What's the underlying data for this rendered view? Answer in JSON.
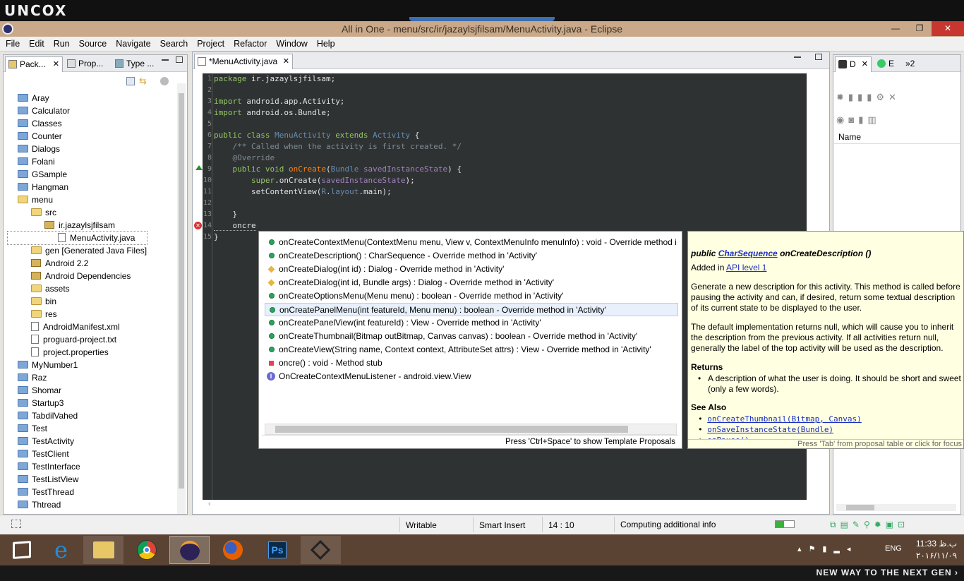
{
  "brand": {
    "logo": "UNCOX",
    "tagline": "NEW WAY TO THE NEXT GEN ›"
  },
  "window": {
    "title": "All in One - menu/src/ir/jazaylsjfilsam/MenuActivity.java - Eclipse",
    "min": "—",
    "max": "❐",
    "close": "✕"
  },
  "menu": [
    "File",
    "Edit",
    "Run",
    "Source",
    "Navigate",
    "Search",
    "Project",
    "Refactor",
    "Window",
    "Help"
  ],
  "left_tabs": [
    "Pack...",
    "Prop...",
    "Type ..."
  ],
  "tree": [
    {
      "label": "Aray",
      "indent": 0,
      "icon": "fold"
    },
    {
      "label": "Calculator",
      "indent": 0,
      "icon": "fold"
    },
    {
      "label": "Classes",
      "indent": 0,
      "icon": "fold"
    },
    {
      "label": "Counter",
      "indent": 0,
      "icon": "fold"
    },
    {
      "label": "Dialogs",
      "indent": 0,
      "icon": "fold"
    },
    {
      "label": "Folani",
      "indent": 0,
      "icon": "fold"
    },
    {
      "label": "GSample",
      "indent": 0,
      "icon": "fold"
    },
    {
      "label": "Hangman",
      "indent": 0,
      "icon": "fold"
    },
    {
      "label": "menu",
      "indent": 0,
      "icon": "open"
    },
    {
      "label": "src",
      "indent": 1,
      "icon": "open"
    },
    {
      "label": "ir.jazaylsjfilsam",
      "indent": 2,
      "icon": "jar"
    },
    {
      "label": "MenuActivity.java",
      "indent": 3,
      "icon": "file"
    },
    {
      "label": "gen [Generated Java Files]",
      "indent": 1,
      "icon": "open"
    },
    {
      "label": "Android 2.2",
      "indent": 1,
      "icon": "jar"
    },
    {
      "label": "Android Dependencies",
      "indent": 1,
      "icon": "jar"
    },
    {
      "label": "assets",
      "indent": 1,
      "icon": "open"
    },
    {
      "label": "bin",
      "indent": 1,
      "icon": "open"
    },
    {
      "label": "res",
      "indent": 1,
      "icon": "open"
    },
    {
      "label": "AndroidManifest.xml",
      "indent": 1,
      "icon": "file"
    },
    {
      "label": "proguard-project.txt",
      "indent": 1,
      "icon": "file"
    },
    {
      "label": "project.properties",
      "indent": 1,
      "icon": "file"
    },
    {
      "label": "MyNumber1",
      "indent": 0,
      "icon": "fold"
    },
    {
      "label": "Raz",
      "indent": 0,
      "icon": "fold"
    },
    {
      "label": "Shomar",
      "indent": 0,
      "icon": "fold"
    },
    {
      "label": "Startup3",
      "indent": 0,
      "icon": "fold"
    },
    {
      "label": "TabdilVahed",
      "indent": 0,
      "icon": "fold"
    },
    {
      "label": "Test",
      "indent": 0,
      "icon": "fold"
    },
    {
      "label": "TestActivity",
      "indent": 0,
      "icon": "fold"
    },
    {
      "label": "TestClient",
      "indent": 0,
      "icon": "fold"
    },
    {
      "label": "TestInterface",
      "indent": 0,
      "icon": "fold"
    },
    {
      "label": "TestListView",
      "indent": 0,
      "icon": "fold"
    },
    {
      "label": "TestThread",
      "indent": 0,
      "icon": "fold"
    },
    {
      "label": "Thtread",
      "indent": 0,
      "icon": "fold"
    }
  ],
  "editor": {
    "tab": "*MenuActivity.java",
    "line_numbers": [
      "1",
      "2",
      "3",
      "4",
      "5",
      "6",
      "7",
      "8",
      "9",
      "10",
      "11",
      "12",
      "13",
      "14",
      "15"
    ],
    "lines": [
      [
        {
          "t": "package ",
          "c": "kw"
        },
        {
          "t": "ir.jazaylsjfilsam;",
          "c": "id"
        }
      ],
      [],
      [
        {
          "t": "import ",
          "c": "kw"
        },
        {
          "t": "android.app.Activity;",
          "c": "id"
        }
      ],
      [
        {
          "t": "import ",
          "c": "kw"
        },
        {
          "t": "android.os.Bundle;",
          "c": "id"
        }
      ],
      [],
      [
        {
          "t": "public class ",
          "c": "kw"
        },
        {
          "t": "MenuActivity ",
          "c": "cls"
        },
        {
          "t": "extends ",
          "c": "kw"
        },
        {
          "t": "Activity ",
          "c": "cls"
        },
        {
          "t": "{",
          "c": "id"
        }
      ],
      [
        {
          "t": "    /** Called when the activity is first created. */",
          "c": "cm"
        }
      ],
      [
        {
          "t": "    @Override",
          "c": "cm"
        }
      ],
      [
        {
          "t": "    public void ",
          "c": "kw"
        },
        {
          "t": "onCreate",
          "c": "fn"
        },
        {
          "t": "(",
          "c": "id"
        },
        {
          "t": "Bundle ",
          "c": "cls"
        },
        {
          "t": "savedInstanceState",
          "c": "ann"
        },
        {
          "t": ") {",
          "c": "id"
        }
      ],
      [
        {
          "t": "        super",
          "c": "kw"
        },
        {
          "t": ".onCreate(",
          "c": "id"
        },
        {
          "t": "savedInstanceState",
          "c": "ann"
        },
        {
          "t": ");",
          "c": "id"
        }
      ],
      [
        {
          "t": "        setContentView(",
          "c": "id"
        },
        {
          "t": "R",
          "c": "cls"
        },
        {
          "t": ".",
          "c": "id"
        },
        {
          "t": "layout",
          "c": "cls"
        },
        {
          "t": ".main);",
          "c": "id"
        }
      ],
      [],
      [
        {
          "t": "    }",
          "c": "id"
        }
      ],
      [
        {
          "t": "    oncre",
          "c": "id"
        }
      ],
      [
        {
          "t": "}",
          "c": "id"
        }
      ]
    ]
  },
  "completion": {
    "items": [
      {
        "icon": "dot",
        "text": "onCreateContextMenu(ContextMenu menu, View v, ContextMenuInfo menuInfo) : void - Override method i"
      },
      {
        "icon": "dot",
        "text": "onCreateDescription() : CharSequence - Override method in 'Activity'"
      },
      {
        "icon": "dia",
        "text": "onCreateDialog(int id) : Dialog - Override method in 'Activity'"
      },
      {
        "icon": "dia",
        "text": "onCreateDialog(int id, Bundle args) : Dialog - Override method in 'Activity'"
      },
      {
        "icon": "dot",
        "text": "onCreateOptionsMenu(Menu menu) : boolean - Override method in 'Activity'"
      },
      {
        "icon": "dot",
        "text": "onCreatePanelMenu(int featureId, Menu menu) : boolean - Override method in 'Activity'"
      },
      {
        "icon": "dot",
        "text": "onCreatePanelView(int featureId) : View - Override method in 'Activity'"
      },
      {
        "icon": "dot",
        "text": "onCreateThumbnail(Bitmap outBitmap, Canvas canvas) : boolean - Override method in 'Activity'"
      },
      {
        "icon": "dot",
        "text": "onCreateView(String name, Context context, AttributeSet attrs) : View - Override method in 'Activity'"
      },
      {
        "icon": "sq",
        "text": "oncre() : void - Method stub"
      },
      {
        "icon": "ib",
        "text": "OnCreateContextMenuListener - android.view.View"
      }
    ],
    "footer": "Press 'Ctrl+Space' to show Template Proposals"
  },
  "doc": {
    "sig_pre": "public",
    "sig_type": "CharSequence",
    "sig_name": "onCreateDescription ()",
    "added_pre": "Added in",
    "added_link": "API level 1",
    "p1": "Generate a new description for this activity. This method is called before pausing the activity and can, if desired, return some textual description of its current state to be displayed to the user.",
    "p2": "The default implementation returns null, which will cause you to inherit the description from the previous activity. If all activities return null, generally the label of the top activity will be used as the description.",
    "returns_h": "Returns",
    "returns_text": "A description of what the user is doing. It should be short and sweet (only a few words).",
    "seealso_h": "See Also",
    "see1": "onCreateThumbnail(Bitmap, Canvas)",
    "see2": "onSaveInstanceState(Bundle)",
    "see3": "onPause()",
    "footer": "Press 'Tab' from proposal table or click for focus"
  },
  "right_panel": {
    "tabs": [
      "D",
      "E",
      "»2"
    ],
    "header": "Name"
  },
  "status": {
    "writable": "Writable",
    "insert": "Smart Insert",
    "pos": "14 : 10",
    "info": "Computing additional info"
  },
  "tray": {
    "lang": "ENG",
    "time": "11:33 ب.ظ",
    "date": "۲۰۱۶/۱۱/۰۹"
  }
}
